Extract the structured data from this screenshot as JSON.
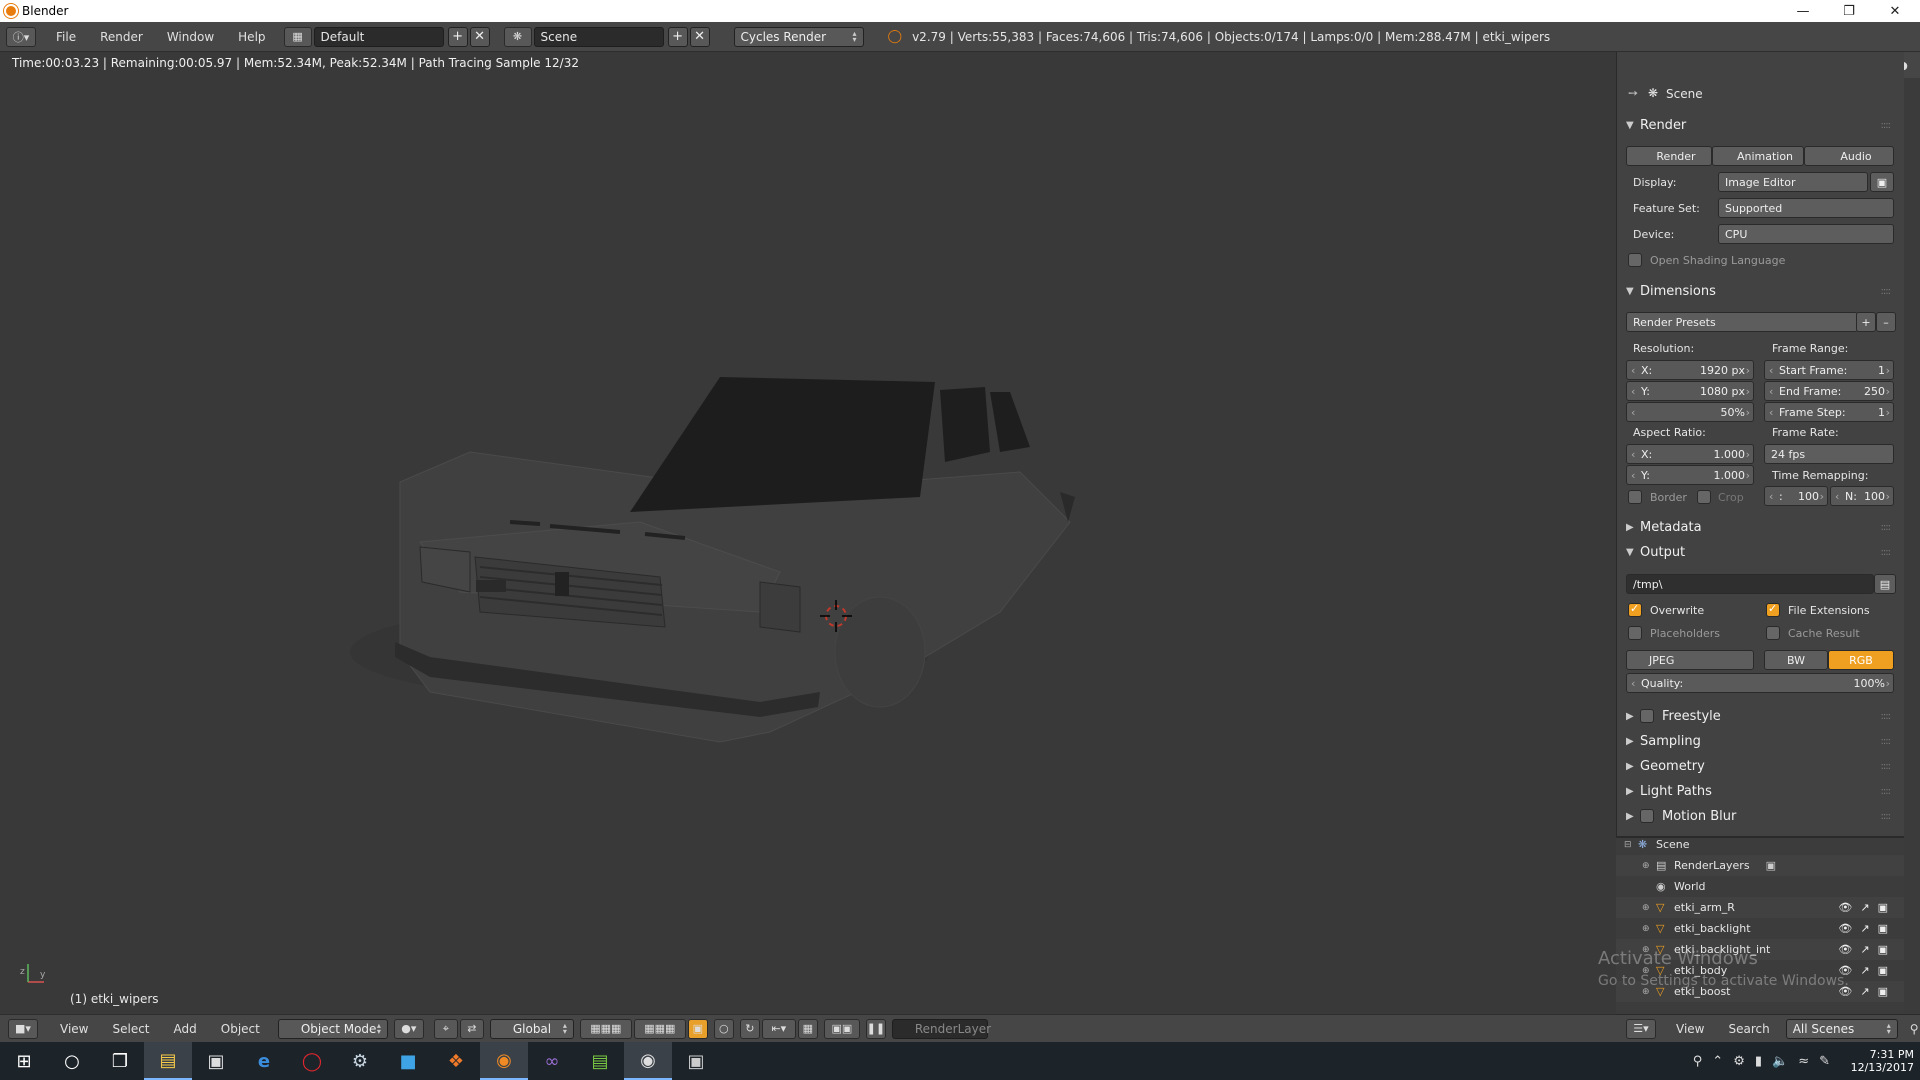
{
  "window": {
    "title": "Blender",
    "controls": [
      "minimize",
      "maximize",
      "close"
    ]
  },
  "infobar": {
    "menus": [
      "File",
      "Render",
      "Window",
      "Help"
    ],
    "layout": "Default",
    "scene": "Scene",
    "engine": "Cycles Render",
    "stats": "v2.79 | Verts:55,383 | Faces:74,606 | Tris:74,606 | Objects:0/174 | Lamps:0/0 | Mem:288.47M | etki_wipers"
  },
  "viewport": {
    "render_status": "Time:00:03.23 | Remaining:00:05.97 | Mem:52.34M, Peak:52.34M | Path Tracing Sample 12/32",
    "object_label": "(1) etki_wipers"
  },
  "view_header": {
    "menus": [
      "View",
      "Select",
      "Add",
      "Object"
    ],
    "mode": "Object Mode",
    "orientation": "Global",
    "render_layer": "RenderLayer"
  },
  "properties": {
    "context": "Scene",
    "render": {
      "title": "Render",
      "buttons": [
        "Render",
        "Animation",
        "Audio"
      ],
      "display_label": "Display:",
      "display": "Image Editor",
      "feature_label": "Feature Set:",
      "feature": "Supported",
      "device_label": "Device:",
      "device": "CPU",
      "osl": "Open Shading Language"
    },
    "dimensions": {
      "title": "Dimensions",
      "presets": "Render Presets",
      "resolution_label": "Resolution:",
      "res_x_label": "X:",
      "res_x": "1920 px",
      "res_y_label": "Y:",
      "res_y": "1080 px",
      "res_pct": "50%",
      "frame_range_label": "Frame Range:",
      "start_label": "Start Frame:",
      "start": "1",
      "end_label": "End Frame:",
      "end": "250",
      "step_label": "Frame Step:",
      "step": "1",
      "aspect_label": "Aspect Ratio:",
      "asp_x_label": "X:",
      "asp_x": "1.000",
      "asp_y_label": "Y:",
      "asp_y": "1.000",
      "frame_rate_label": "Frame Rate:",
      "frame_rate": "24 fps",
      "remap_label": "Time Remapping:",
      "remap_old_label": ":",
      "remap_old": "100",
      "remap_new_label": "N:",
      "remap_new": "100",
      "border": "Border",
      "crop": "Crop"
    },
    "metadata": {
      "title": "Metadata"
    },
    "output": {
      "title": "Output",
      "path": "/tmp\\",
      "overwrite": "Overwrite",
      "file_ext": "File Extensions",
      "placeholders": "Placeholders",
      "cache": "Cache Result",
      "format": "JPEG",
      "bw": "BW",
      "rgb": "RGB",
      "quality_label": "Quality:",
      "quality": "100%"
    },
    "collapsed_panels": [
      "Freestyle",
      "Sampling",
      "Geometry",
      "Light Paths",
      "Motion Blur"
    ]
  },
  "outliner": {
    "items": [
      "Scene",
      "RenderLayers",
      "World",
      "etki_arm_R",
      "etki_backlight",
      "etki_backlight_int",
      "etki_body",
      "etki_boost"
    ],
    "header_menus": [
      "View",
      "Search"
    ],
    "filter": "All Scenes"
  },
  "watermark": {
    "line1": "Activate Windows",
    "line2": "Go to Settings to activate Windows."
  },
  "taskbar": {
    "time": "7:31 PM",
    "date": "12/13/2017"
  },
  "colors": {
    "accent": "#f0a020",
    "background": "#393939",
    "panel": "#424242",
    "header": "#464646"
  }
}
